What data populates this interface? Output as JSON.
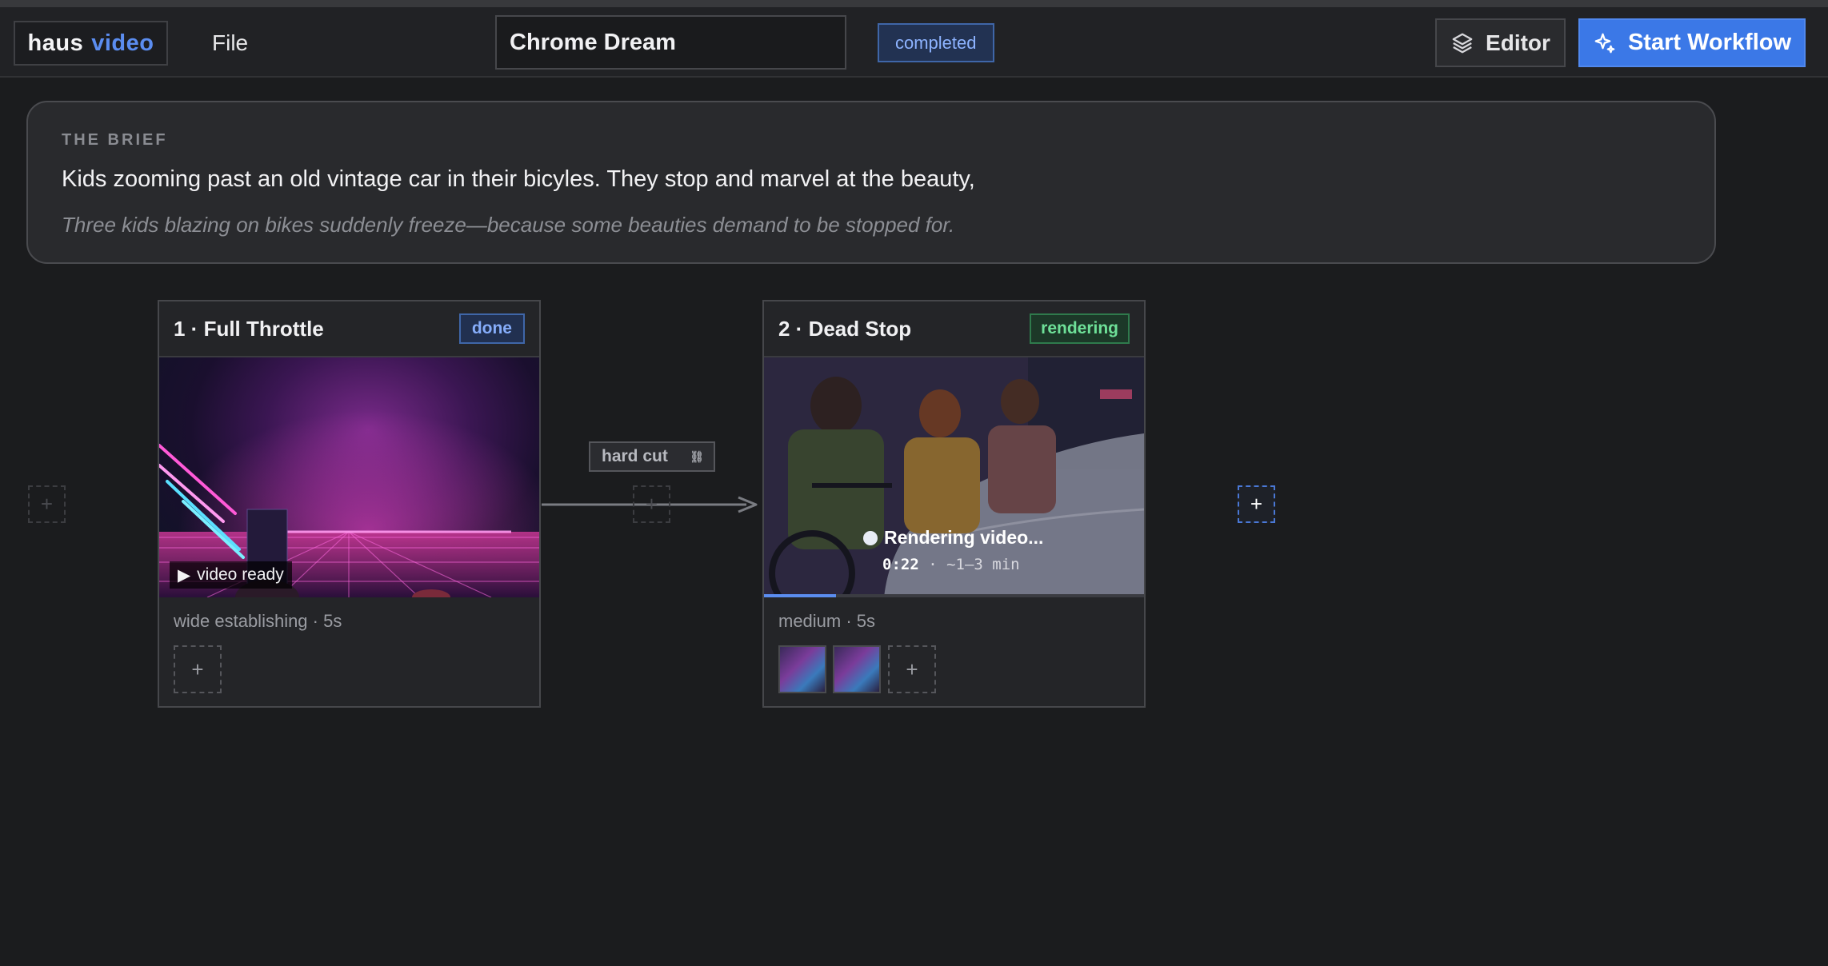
{
  "header": {
    "logo_part1": "haus",
    "logo_part2": "video",
    "file_menu": "File",
    "project_title": "Chrome Dream",
    "status": "completed",
    "editor_label": "Editor",
    "start_label": "Start Workflow"
  },
  "brief": {
    "kicker": "THE BRIEF",
    "text": "Kids zooming past an old vintage car in their bicyles. They stop and marvel at the beauty,",
    "subtext": "Three kids blazing on bikes suddenly freeze—because some beauties demand to be stopped for."
  },
  "shots": [
    {
      "title": "1 · Full Throttle",
      "badge": "done",
      "video_tag": "video ready",
      "meta": "wide establishing · 5s"
    },
    {
      "title": "2 · Dead Stop",
      "badge": "rendering",
      "render_status": "Rendering video...",
      "render_elapsed": "0:22",
      "render_eta": " · ~1–3 min",
      "progress": 0.19,
      "meta": "medium · 5s"
    }
  ],
  "transition": {
    "label": "hard cut",
    "chain_icon": "link-icon"
  },
  "colors": {
    "accent": "#3b78e7",
    "done_badge": "#86adfa",
    "rendering_badge": "#6ee098"
  }
}
